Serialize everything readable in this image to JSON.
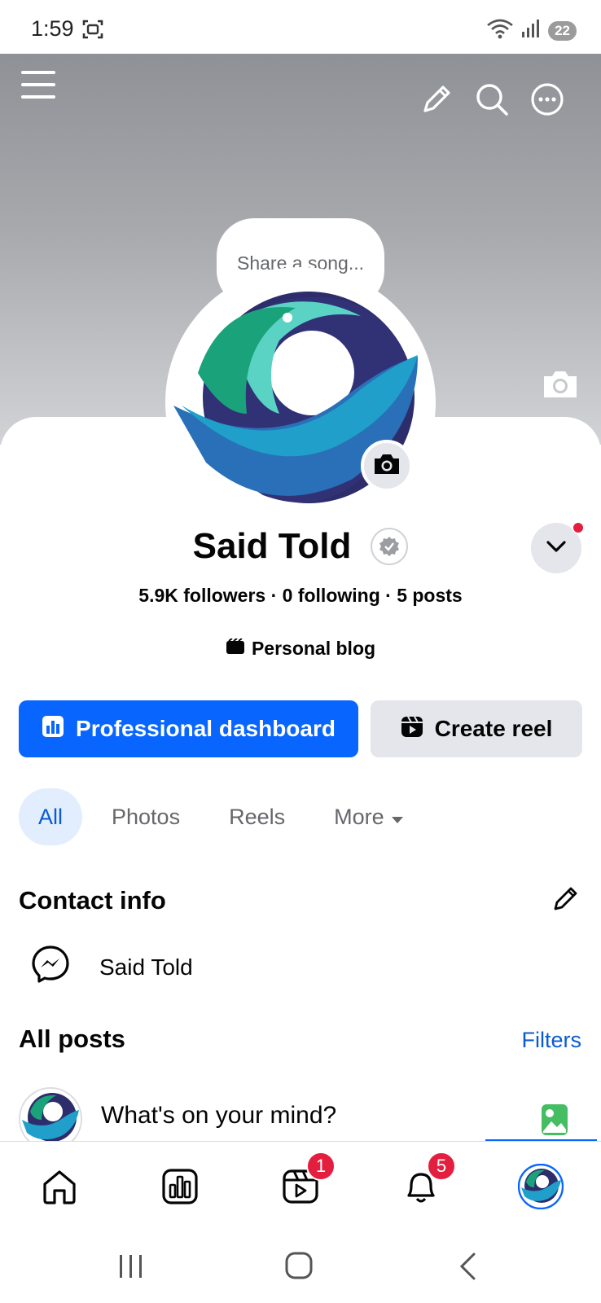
{
  "status_bar": {
    "time": "1:59",
    "battery": "22"
  },
  "cover": {
    "icons": [
      "menu-icon",
      "pencil-icon",
      "search-icon",
      "more-icon",
      "camera-icon"
    ]
  },
  "profile": {
    "song_prompt": "Share a song...",
    "name": "Said Told",
    "stats": "5.9K followers · 0 following · 5 posts",
    "category": "Personal blog"
  },
  "actions": {
    "dashboard_label": "Professional dashboard",
    "reel_label": "Create reel"
  },
  "tabs": [
    {
      "label": "All",
      "active": true
    },
    {
      "label": "Photos",
      "active": false
    },
    {
      "label": "Reels",
      "active": false
    },
    {
      "label": "More",
      "active": false
    }
  ],
  "contact": {
    "title": "Contact info",
    "messenger_name": "Said Told"
  },
  "posts": {
    "title": "All posts",
    "filters_label": "Filters",
    "composer_placeholder": "What's on your mind?"
  },
  "bottom_nav": {
    "items": [
      {
        "name": "home",
        "badge": ""
      },
      {
        "name": "dashboard",
        "badge": ""
      },
      {
        "name": "reels",
        "badge": "1"
      },
      {
        "name": "notifications",
        "badge": "5"
      },
      {
        "name": "profile",
        "badge": ""
      }
    ]
  },
  "colors": {
    "accent": "#0866ff",
    "badge": "#e41e3f",
    "tab_active_bg": "#e2edfd"
  }
}
